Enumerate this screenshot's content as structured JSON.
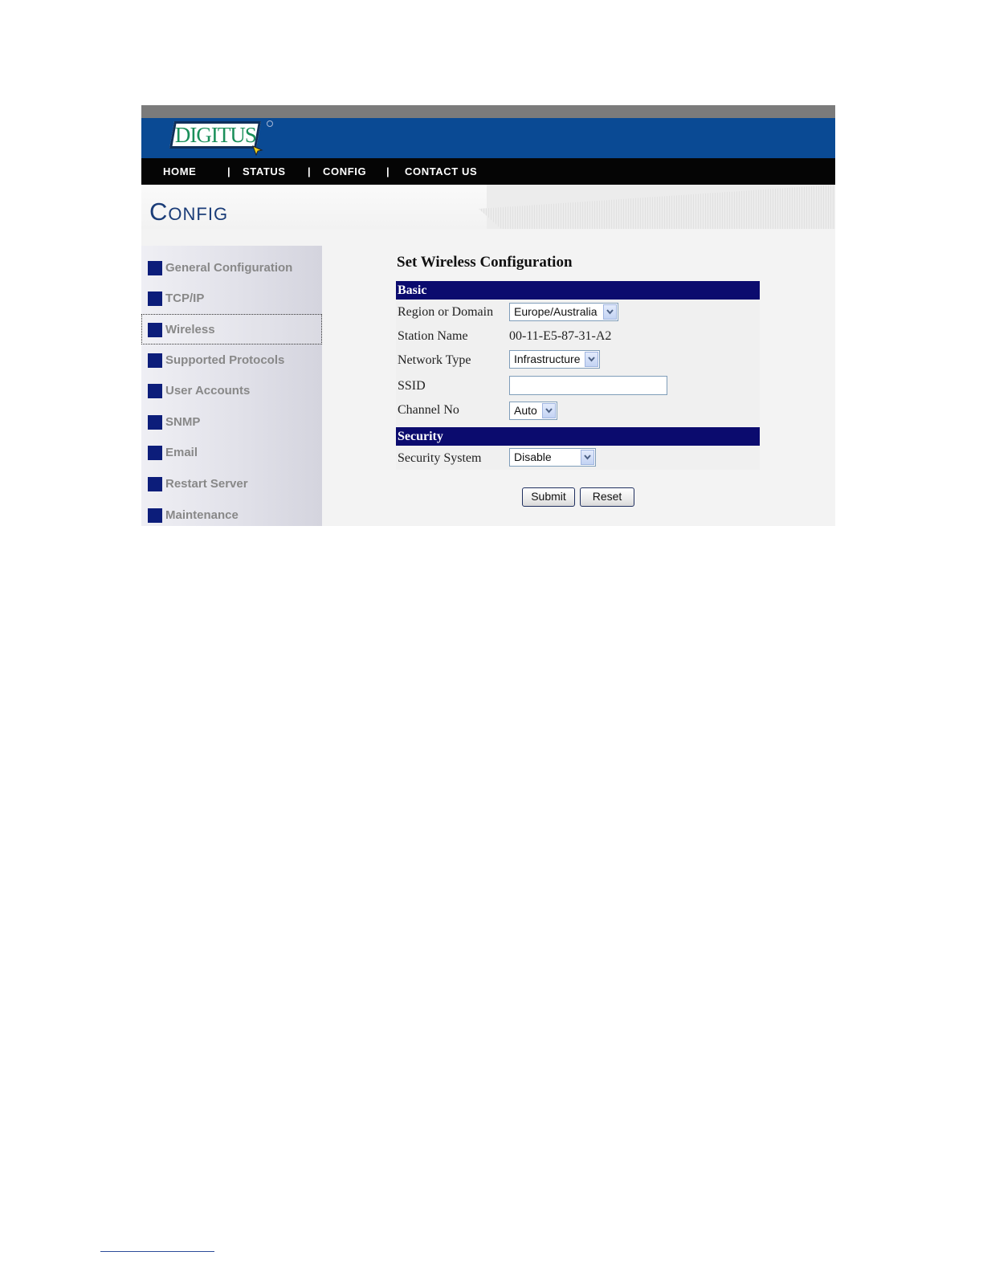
{
  "brand": {
    "logo_text": "DIGITUS"
  },
  "nav": {
    "items": [
      "HOME",
      "STATUS",
      "CONFIG",
      "CONTACT US"
    ],
    "separator": "|"
  },
  "page": {
    "title": "Config"
  },
  "sidebar": {
    "items": [
      {
        "label": "General Configuration"
      },
      {
        "label": "TCP/IP"
      },
      {
        "label": "Wireless",
        "active": true
      },
      {
        "label": "Supported Protocols"
      },
      {
        "label": "User Accounts"
      },
      {
        "label": "SNMP"
      },
      {
        "label": "Email"
      },
      {
        "label": "Restart Server"
      },
      {
        "label": "Maintenance"
      }
    ]
  },
  "form": {
    "heading": "Set Wireless Configuration",
    "basic": {
      "title": "Basic",
      "region_label": "Region or Domain",
      "region_value": "Europe/Australia",
      "station_label": "Station Name",
      "station_value": "00-11-E5-87-31-A2",
      "network_label": "Network Type",
      "network_value": "Infrastructure",
      "ssid_label": "SSID",
      "ssid_value": "",
      "channel_label": "Channel No",
      "channel_value": "Auto"
    },
    "security": {
      "title": "Security",
      "system_label": "Security System",
      "system_value": "Disable"
    },
    "submit_label": "Submit",
    "reset_label": "Reset"
  },
  "colors": {
    "banner": "#0a4a94",
    "navbar": "#050505",
    "section_bar": "#0b0b6e",
    "sidebar_marker": "#0c1d7a",
    "title": "#1a3c78"
  }
}
